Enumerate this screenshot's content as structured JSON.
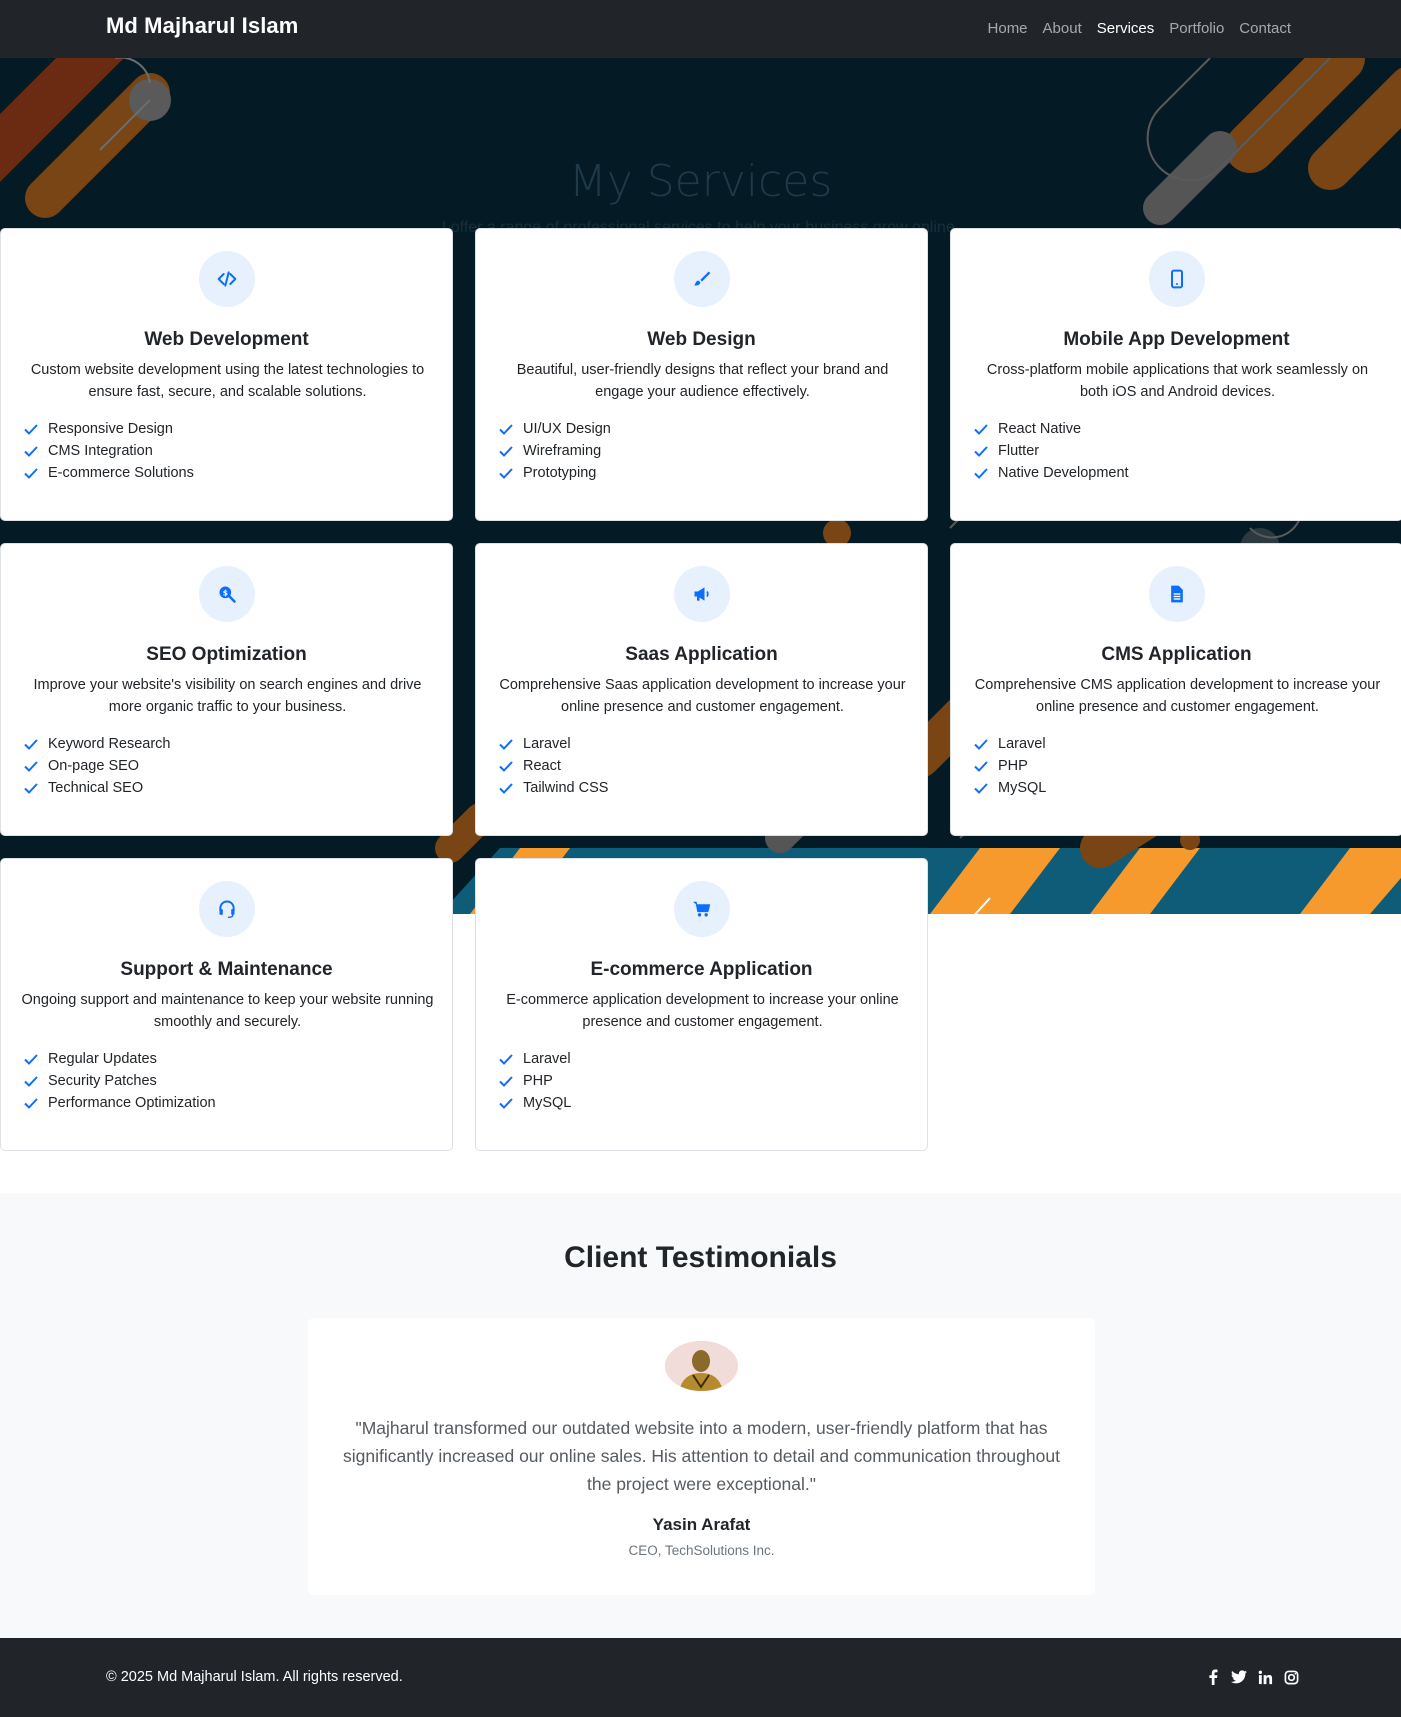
{
  "navbar": {
    "brand": "Md Majharul Islam",
    "links": [
      {
        "label": "Home"
      },
      {
        "label": "About"
      },
      {
        "label": "Services",
        "active": true
      },
      {
        "label": "Portfolio"
      },
      {
        "label": "Contact"
      }
    ]
  },
  "hero": {
    "title": "My Services",
    "subtitle": "I offer a range of professional services to help your business grow online."
  },
  "colors": {
    "accent": "#0d6efd",
    "icon_bg": "#e7f0fd",
    "navbar_bg": "#212529",
    "hero_bg": "#041a24",
    "orange": "#f79a2e",
    "teal": "#0f5c78"
  },
  "services": [
    {
      "icon": "code-icon",
      "title": "Web Development",
      "desc": "Custom website development using the latest technologies to ensure fast, secure, and scalable solutions.",
      "features": [
        "Responsive Design",
        "CMS Integration",
        "E-commerce Solutions"
      ]
    },
    {
      "icon": "paintbrush-icon",
      "title": "Web Design",
      "desc": "Beautiful, user-friendly designs that reflect your brand and engage your audience effectively.",
      "features": [
        "UI/UX Design",
        "Wireframing",
        "Prototyping"
      ]
    },
    {
      "icon": "mobile-icon",
      "title": "Mobile App Development",
      "desc": "Cross-platform mobile applications that work seamlessly on both iOS and Android devices.",
      "features": [
        "React Native",
        "Flutter",
        "Native Development"
      ]
    },
    {
      "icon": "search-dollar-icon",
      "title": "SEO Optimization",
      "desc": "Improve your website's visibility on search engines and drive more organic traffic to your business.",
      "features": [
        "Keyword Research",
        "On-page SEO",
        "Technical SEO"
      ]
    },
    {
      "icon": "megaphone-icon",
      "title": "Saas Application",
      "desc": "Comprehensive Saas application development to increase your online presence and customer engagement.",
      "features": [
        "Laravel",
        "React",
        "Tailwind CSS"
      ]
    },
    {
      "icon": "file-icon",
      "title": "CMS Application",
      "desc": "Comprehensive CMS application development to increase your online presence and customer engagement.",
      "features": [
        "Laravel",
        "PHP",
        "MySQL"
      ]
    },
    {
      "icon": "headset-icon",
      "title": "Support & Maintenance",
      "desc": "Ongoing support and maintenance to keep your website running smoothly and securely.",
      "features": [
        "Regular Updates",
        "Security Patches",
        "Performance Optimization"
      ]
    },
    {
      "icon": "cart-icon",
      "title": "E-commerce Application",
      "desc": "E-commerce application development to increase your online presence and customer engagement.",
      "features": [
        "Laravel",
        "PHP",
        "MySQL"
      ]
    }
  ],
  "testimonials": {
    "heading": "Client Testimonials",
    "quote": "\"Majharul transformed our outdated website into a modern, user-friendly platform that has significantly increased our online sales. His attention to detail and communication throughout the project were exceptional.\"",
    "name": "Yasin Arafat",
    "role": "CEO, TechSolutions Inc."
  },
  "footer": {
    "copyright": "© 2025 Md Majharul Islam. All rights reserved.",
    "social": [
      {
        "icon": "facebook-icon",
        "glyph": "f"
      },
      {
        "icon": "twitter-icon",
        "glyph": "t"
      },
      {
        "icon": "linkedin-icon",
        "glyph": "in"
      },
      {
        "icon": "instagram-icon",
        "glyph": "ig"
      }
    ]
  }
}
